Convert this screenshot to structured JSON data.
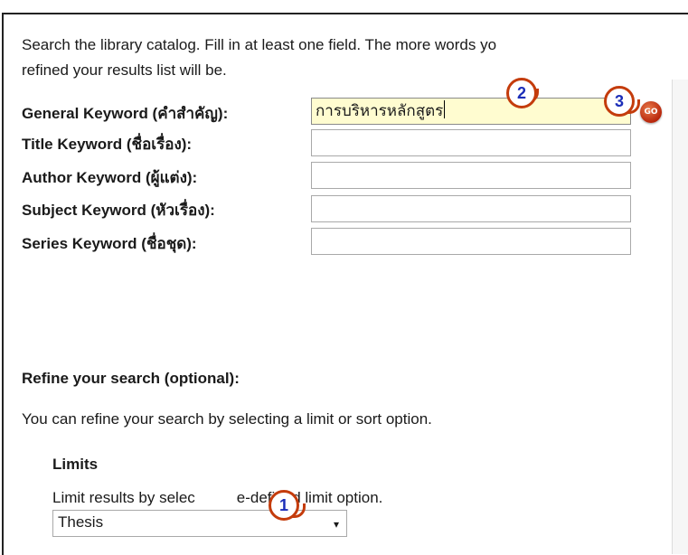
{
  "intro": {
    "line1": "Search the library catalog. Fill in at least one field. The more words yo",
    "line2": "refined your results list will be."
  },
  "fields": [
    {
      "label": "General Keyword (คำสำคัญ):",
      "value": "การบริหารหลักสูตร",
      "active": true
    },
    {
      "label": "Title Keyword (ชื่อเรื่อง):",
      "value": ""
    },
    {
      "label": "Author Keyword (ผู้แต่ง):",
      "value": ""
    },
    {
      "label": "Subject Keyword (หัวเรื่อง):",
      "value": ""
    },
    {
      "label": "Series Keyword (ชื่อชุด):",
      "value": ""
    }
  ],
  "go_button": {
    "label": "GO"
  },
  "refine": {
    "heading": "Refine your search (optional):",
    "text": "You can refine your search by selecting a limit or sort option."
  },
  "limits": {
    "heading": "Limits",
    "text": "Limit results by selec",
    "text_after": "e-defined limit option.",
    "selected": "Thesis",
    "arrow": "▾"
  },
  "callouts": [
    "1",
    "2",
    "3"
  ],
  "colors": {
    "callout_border": "#c43c0c",
    "callout_text": "#1b2db8",
    "active_input": "#fffcd0"
  }
}
